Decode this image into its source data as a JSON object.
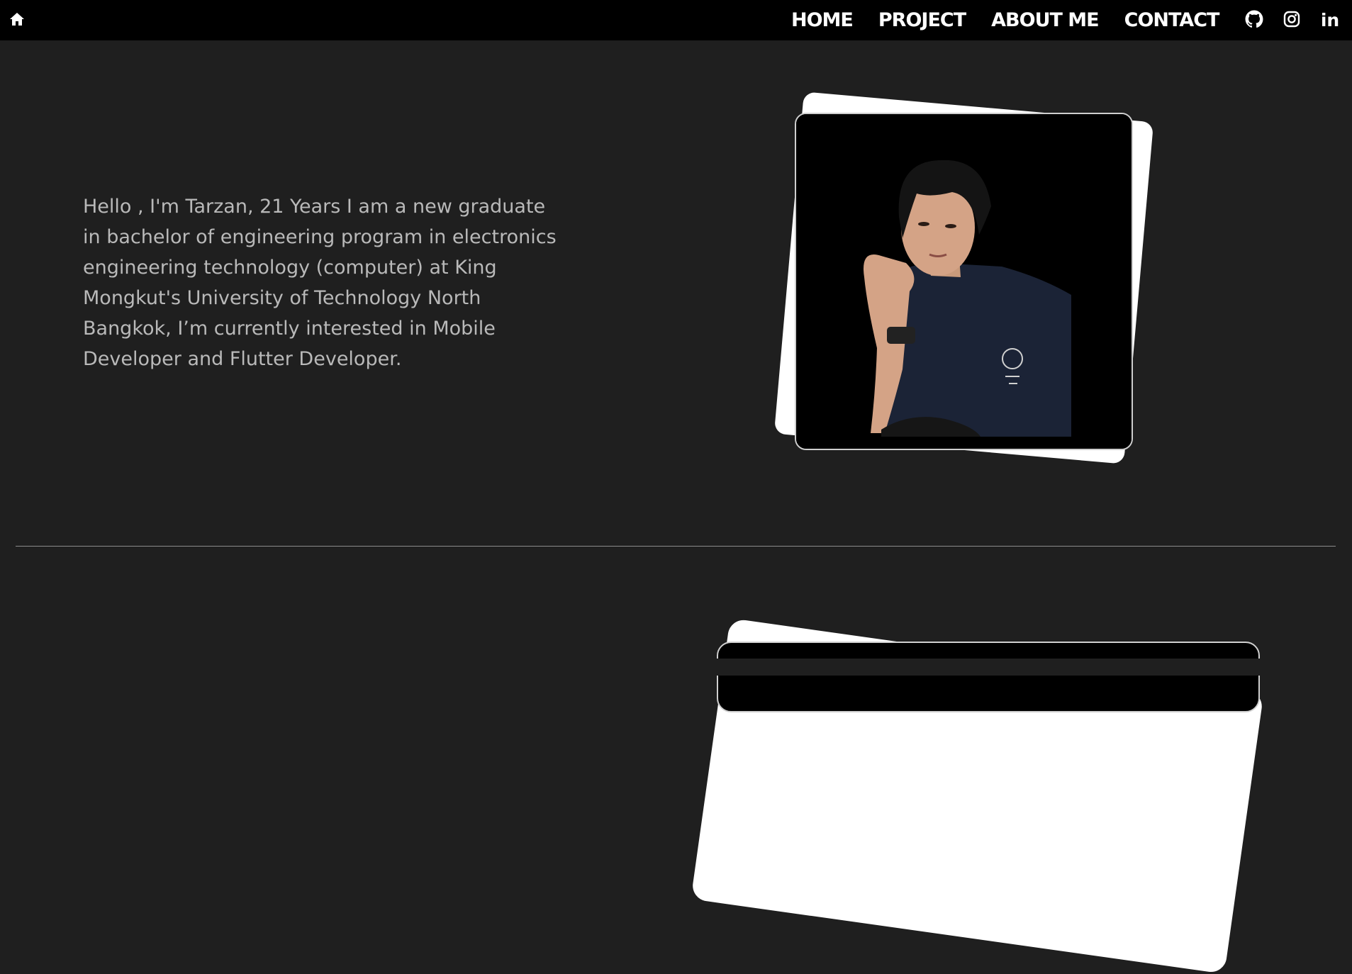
{
  "nav": {
    "home_icon": "home-icon",
    "links": [
      "HOME",
      "PROJECT",
      "ABOUT ME",
      "CONTACT"
    ],
    "social": {
      "github_icon": "github-icon",
      "instagram_icon": "instagram-icon",
      "linkedin_label": "in"
    }
  },
  "intro": {
    "text": "Hello , I'm Tarzan,  21 Years I am a new graduate in bachelor of engineering program in electronics engineering technology (computer) at King Mongkut's University of Technology North Bangkok, I’m currently interested in Mobile Developer and Flutter Developer."
  },
  "colors": {
    "page_bg": "#1f1f1f",
    "nav_bg": "#000000",
    "text": "#b9b9b9",
    "card_accent": "#ffffff"
  }
}
